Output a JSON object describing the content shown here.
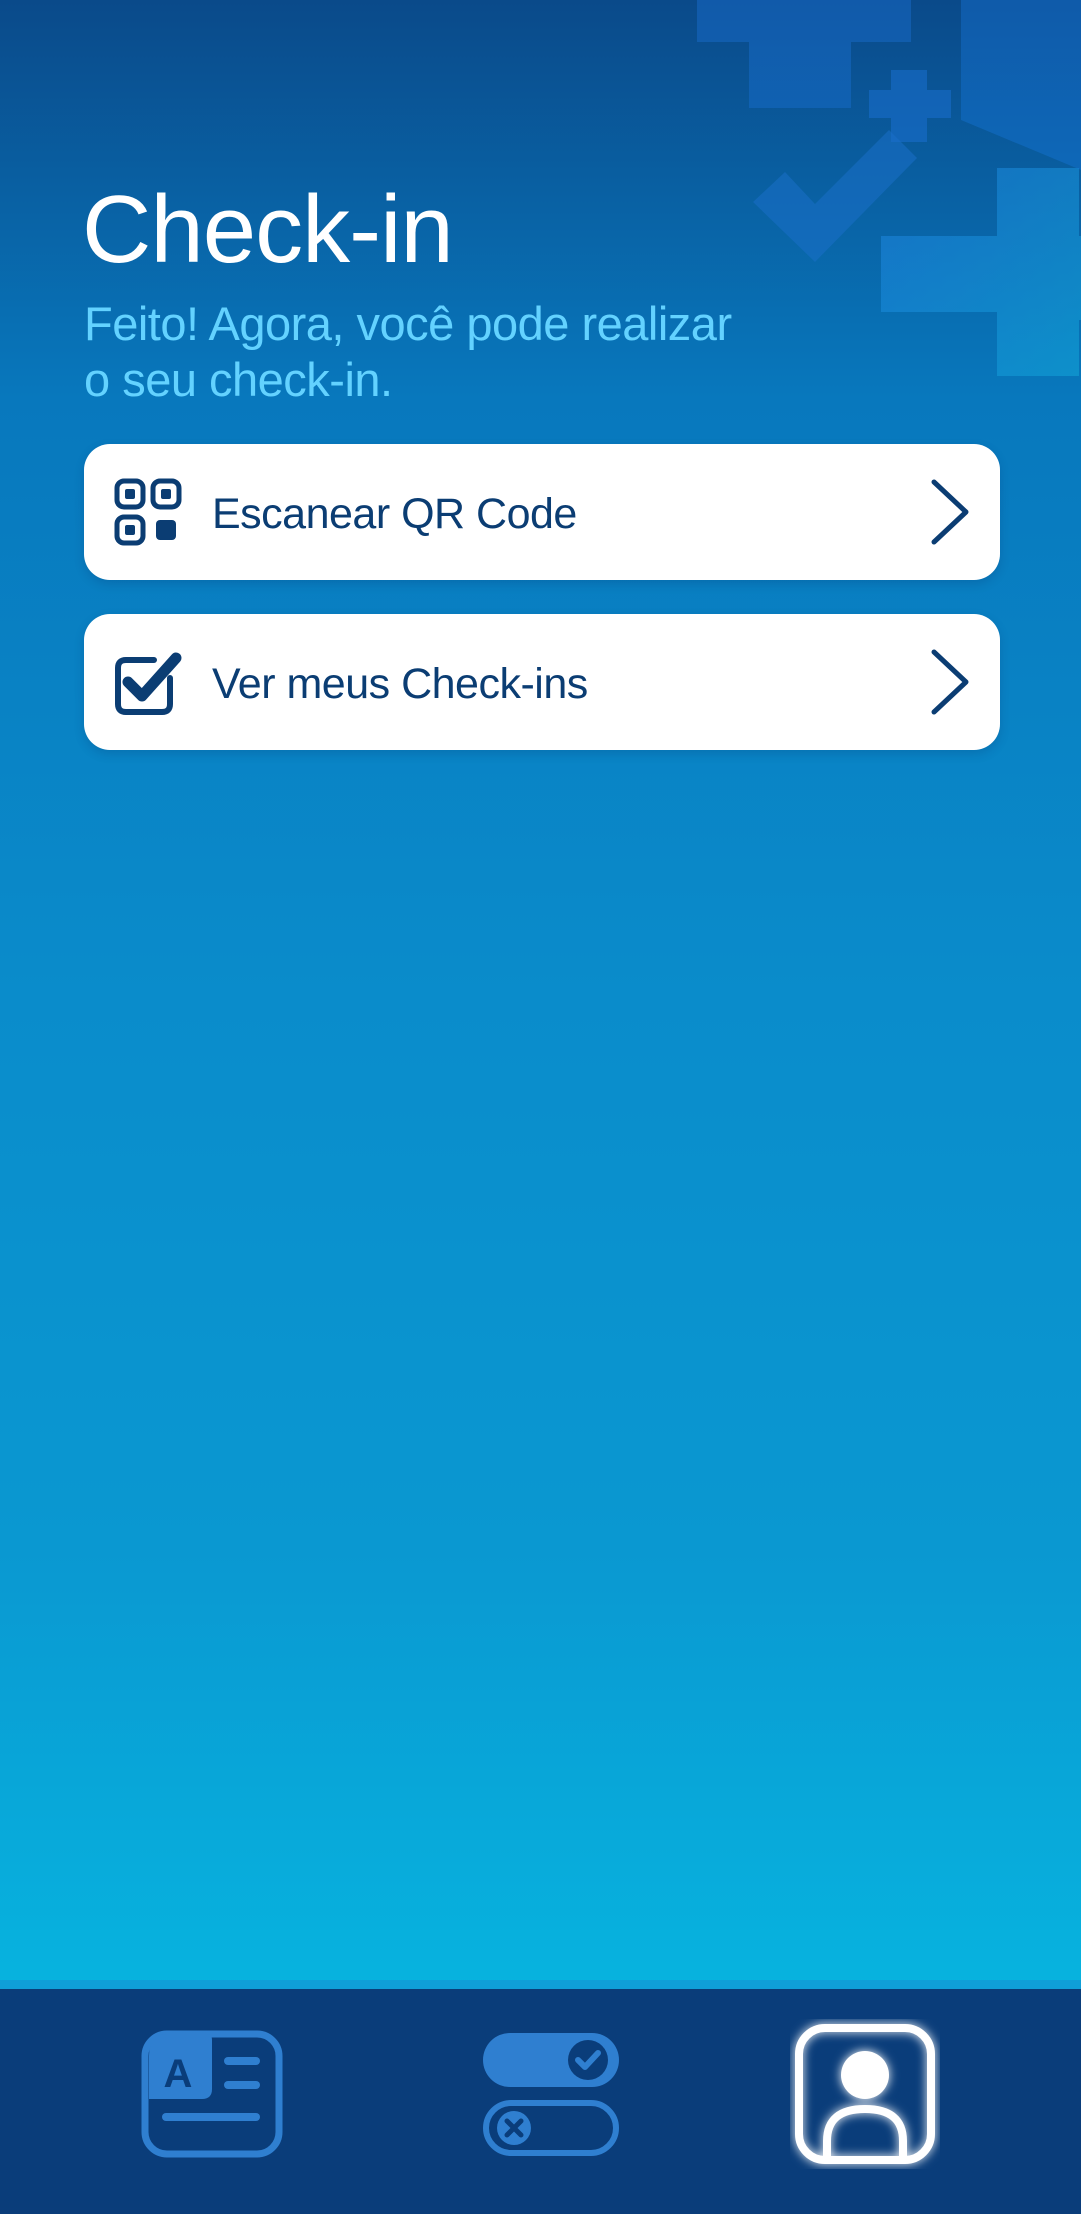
{
  "header": {
    "title": "Check-in",
    "subtitle": "Feito! Agora, você pode realizar o seu check-in."
  },
  "menu": [
    {
      "label": "Escanear QR Code",
      "icon": "qr-code-icon",
      "action_icon": "chevron-right-icon"
    },
    {
      "label": "Ver meus Check-ins",
      "icon": "checkbox-checked-icon",
      "action_icon": "chevron-right-icon"
    }
  ],
  "bottom_nav": {
    "items": [
      {
        "icon": "document-card-icon",
        "active": false
      },
      {
        "icon": "toggle-switches-icon",
        "active": false
      },
      {
        "icon": "user-profile-icon",
        "active": true
      }
    ]
  },
  "colors": {
    "background_top": "#0a4a8a",
    "background_bottom": "#05c1e6",
    "subtitle": "#63d2ff",
    "card_text": "#0b3d73",
    "nav_background": "#0a3d7a",
    "nav_icon_inactive": "#2f7fd0",
    "nav_icon_active": "#ffffff"
  }
}
